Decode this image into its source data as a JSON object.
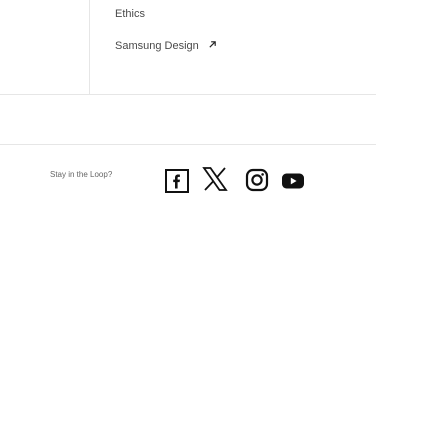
{
  "footer": {
    "links": [
      {
        "label": "Ethics"
      },
      {
        "label": "Samsung Design"
      }
    ],
    "external_icon": "external-link-icon",
    "social": {
      "label": "Stay in the Loop?",
      "icons": [
        "facebook-icon",
        "x-icon",
        "instagram-icon",
        "youtube-icon"
      ]
    }
  },
  "colors": {
    "text": "#4a4a4a",
    "divider": "#e6e6e6",
    "icon": "#111111"
  }
}
